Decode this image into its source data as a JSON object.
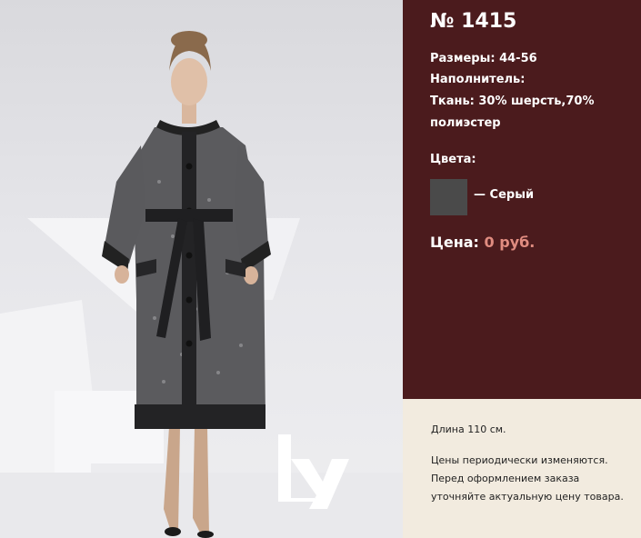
{
  "product": {
    "title": "№ 1415",
    "sizes": "Размеры: 44-56",
    "filler": "Наполнитель:",
    "fabric_line1": "Ткань: 30% шерсть,70%",
    "fabric_line2": "полиэстер",
    "colors_label": "Цвета:",
    "colors": [
      {
        "name": "— Серый",
        "hex": "#4a4a4a"
      }
    ],
    "price_label": "Цена:",
    "price_value": "0 руб."
  },
  "notes": {
    "length": "Длина 110 см.",
    "price_note_line1": "Цены периодически изменяются.",
    "price_note_line2": "Перед оформлением заказа",
    "price_note_line3": "уточняйте актуальную цену товара."
  },
  "colors": {
    "panel_bg": "#4b1b1d",
    "page_bg": "#f2ebdf",
    "price_value": "#e08c80"
  }
}
